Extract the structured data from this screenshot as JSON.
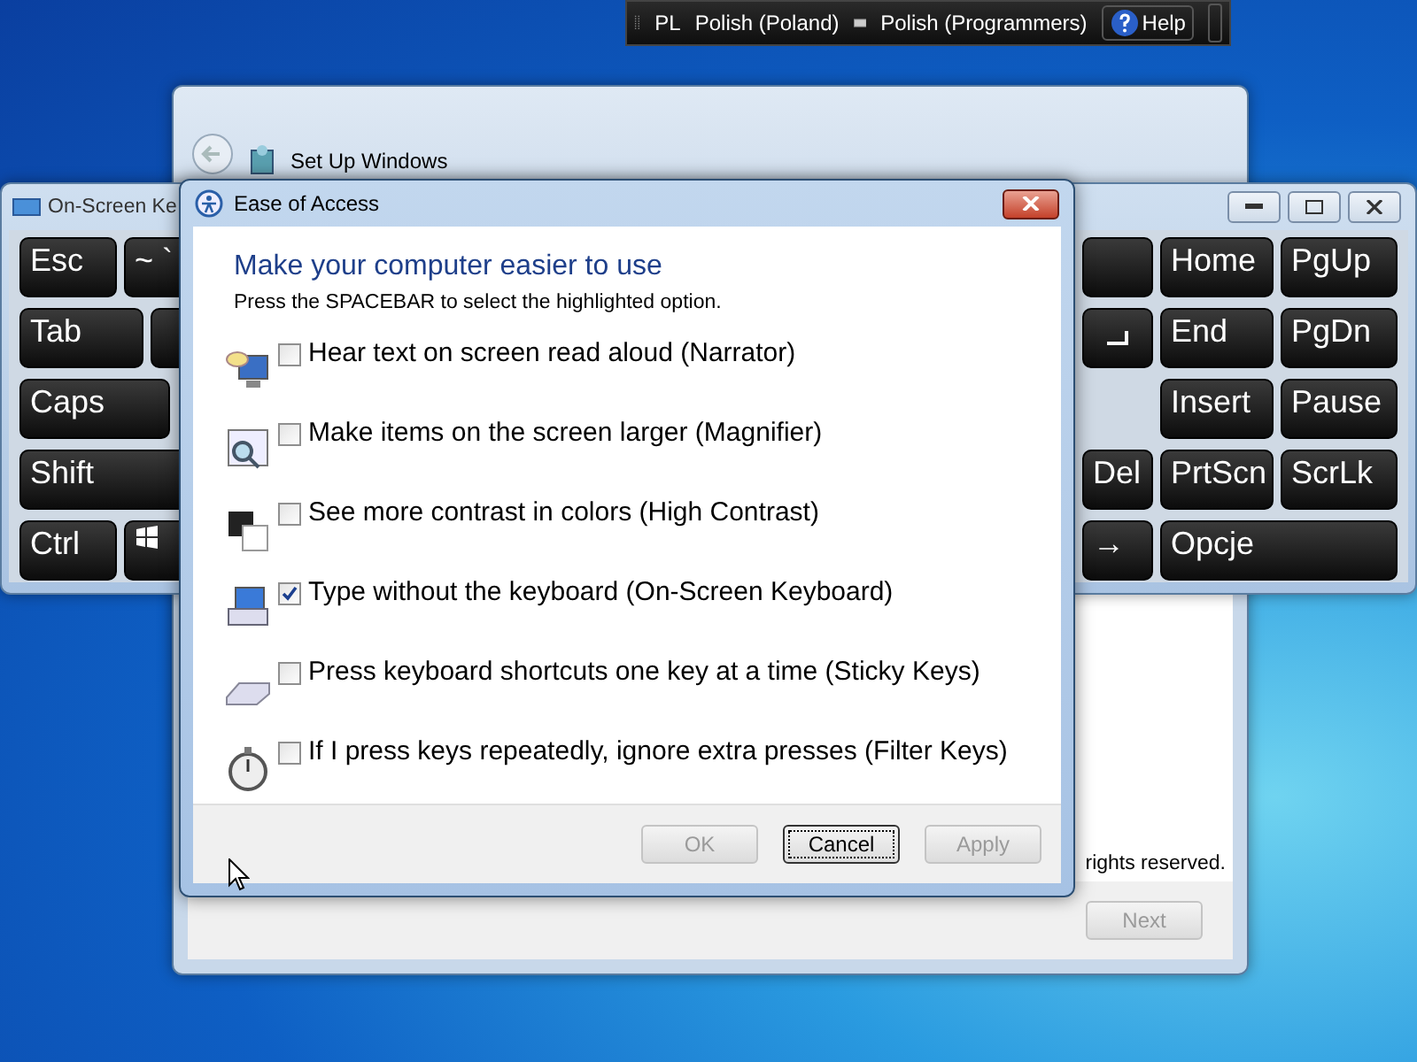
{
  "language_bar": {
    "language_code": "PL",
    "language": "Polish (Poland)",
    "keyboard_layout": "Polish (Programmers)",
    "help": "Help"
  },
  "setup_window": {
    "title": "Set Up Windows",
    "footer_text": "rights reserved.",
    "next_button": {
      "label": "Next",
      "disabled": true
    }
  },
  "keyboard_window": {
    "title": "On-Screen Ke",
    "left_rows": [
      [
        {
          "kind": "key",
          "label": "Esc"
        },
        {
          "kind": "key",
          "label": "~ `"
        }
      ],
      [
        {
          "kind": "key",
          "label": "Tab"
        },
        {
          "kind": "blank"
        }
      ],
      [
        {
          "kind": "key",
          "label": "Caps"
        }
      ],
      [
        {
          "kind": "key",
          "label": "Shift"
        }
      ],
      [
        {
          "kind": "key",
          "label": "Ctrl"
        },
        {
          "kind": "windows"
        }
      ]
    ],
    "right_keys": [
      {
        "kind": "blank"
      },
      {
        "kind": "key",
        "label": "Home"
      },
      {
        "kind": "key",
        "label": "PgUp"
      },
      {
        "kind": "enter"
      },
      {
        "kind": "key",
        "label": "End"
      },
      {
        "kind": "key",
        "label": "PgDn"
      },
      {
        "kind": "key",
        "label": "Insert"
      },
      {
        "kind": "key",
        "label": "Pause"
      },
      {
        "kind": "key",
        "label": "Del"
      },
      {
        "kind": "key",
        "label": "PrtScn"
      },
      {
        "kind": "key",
        "label": "ScrLk"
      },
      {
        "kind": "key",
        "label": "→"
      },
      {
        "kind": "key",
        "label": "Opcje"
      }
    ]
  },
  "dialog": {
    "title": "Ease of Access",
    "heading": "Make your computer easier to use",
    "instruction": "Press the SPACEBAR to select the highlighted option.",
    "options": [
      {
        "kind": "narrator",
        "label": "Hear text on screen read aloud (Narrator)",
        "checked": false
      },
      {
        "kind": "magnifier",
        "label": "Make items on the screen larger (Magnifier)",
        "checked": false
      },
      {
        "kind": "contrast",
        "label": "See more contrast in colors (High Contrast)",
        "checked": false
      },
      {
        "kind": "keyboard",
        "label": "Type without the keyboard (On-Screen Keyboard)",
        "checked": true
      },
      {
        "kind": "sticky",
        "label": "Press keyboard shortcuts one key at a time (Sticky Keys)",
        "checked": false
      },
      {
        "kind": "filter",
        "label": "If I press keys repeatedly, ignore extra presses (Filter Keys)",
        "checked": false
      }
    ],
    "buttons": [
      {
        "label": "OK",
        "disabled": true,
        "focused": false
      },
      {
        "label": "Cancel",
        "disabled": false,
        "focused": true
      },
      {
        "label": "Apply",
        "disabled": true,
        "focused": false
      }
    ]
  }
}
